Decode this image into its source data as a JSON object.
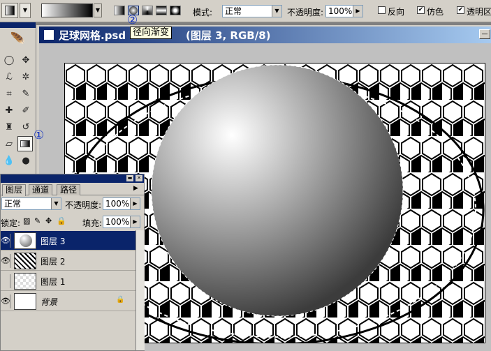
{
  "options_bar": {
    "mode_label": "模式:",
    "mode_value": "正常",
    "opacity_label": "不透明度:",
    "opacity_value": "100%",
    "reverse_label": "反向",
    "dither_label": "仿色",
    "transparency_label": "透明区",
    "reverse_checked": false,
    "dither_checked": true,
    "transparency_checked": true
  },
  "document": {
    "title": "足球网格.psd",
    "mode": "(图层 3, RGB/8)",
    "tooltip": "径向渐变"
  },
  "markers": {
    "one": "①",
    "two": "②"
  },
  "layers_panel": {
    "tabs": [
      {
        "label": "图层"
      },
      {
        "label": "通道"
      },
      {
        "label": "路径"
      }
    ],
    "blend_mode": "正常",
    "opacity_label": "不透明度:",
    "opacity_value": "100%",
    "lock_label": "锁定:",
    "fill_label": "填充:",
    "fill_value": "100%",
    "layers": [
      {
        "name": "图层 3",
        "visible": true,
        "selected": true
      },
      {
        "name": "图层 2",
        "visible": true,
        "selected": false
      },
      {
        "name": "图层 1",
        "visible": false,
        "selected": false
      },
      {
        "name": "背景",
        "visible": true,
        "selected": false,
        "locked": true
      }
    ]
  },
  "colors": {
    "title_bar": "#0a246a",
    "selection": "#0a246a",
    "marker": "#1030c0"
  }
}
